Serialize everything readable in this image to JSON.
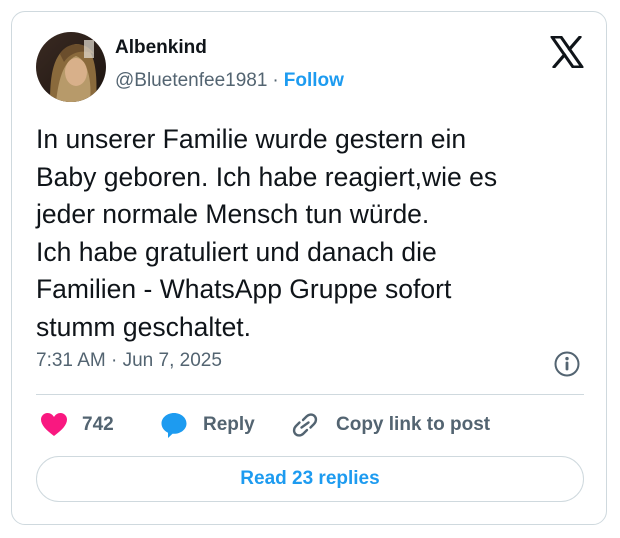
{
  "user": {
    "display_name": "Albenkind",
    "handle": "@Bluetenfee1981",
    "separator": "·",
    "follow_label": "Follow"
  },
  "tweet": {
    "lines": [
      "In unserer Familie wurde gestern ein",
      "Baby geboren. Ich habe reagiert,wie es",
      "jeder normale Mensch tun würde.",
      "Ich habe gratuliert und danach die",
      "Familien - WhatsApp Gruppe sofort",
      "stumm geschaltet."
    ],
    "timestamp": "7:31 AM · Jun 7, 2025"
  },
  "actions": {
    "like_count": "742",
    "reply_label": "Reply",
    "copy_label": "Copy link to post"
  },
  "replies_button": "Read 23 replies",
  "colors": {
    "accent": "#1d9bf0",
    "like": "#f91880",
    "text": "#0f1419",
    "secondary": "#536471",
    "border": "#cfd9de"
  }
}
